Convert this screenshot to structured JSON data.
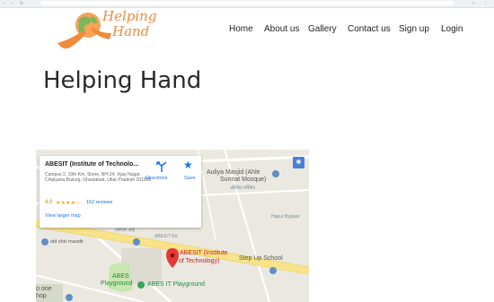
{
  "header": {
    "logo_line1": "Helping",
    "logo_line2": "Hand",
    "nav": [
      {
        "label": "Home"
      },
      {
        "label": "About us"
      },
      {
        "label": "Gallery"
      },
      {
        "label": "Contact us"
      },
      {
        "label": "Sign up"
      },
      {
        "label": "Login"
      }
    ]
  },
  "hero": {
    "title": "Helping Hand"
  },
  "map": {
    "card": {
      "name": "ABESIT (Institute of Technolo...",
      "address": "Campus 2, 19th Km, Stone, NH-24, Vijay Nagar, Chipiyana Buzurg, Ghaziabad, Uttar Pradesh 201009",
      "rating": "4.0",
      "stars": "★★★★☆",
      "reviews": "162 reviews",
      "directions": "Directions",
      "save": "Save",
      "larger_map": "View larger map"
    },
    "labels": {
      "masjid1": "Auliya Masjid (Ahle",
      "masjid2": "Sunnat Mosque)",
      "masjid_hindi": "औलिया मस्जिद",
      "old_shiv": "old shiv mandir",
      "abesit1": "ABESIT (Institute",
      "abesit2": "of Technology)",
      "stepup": "Step Up School",
      "abes_playground1": "ABES",
      "abes_playground2": "Playground",
      "abes_it_playground": "ABES IT Playground",
      "hapur_bypass": "Hapur Bypass",
      "abesit_road": "ABESIT Rd",
      "hindi_small": "एबीएस आई",
      "one1": "o one",
      "one2": "hop"
    },
    "colors": {
      "marker_red": "#e53935",
      "poi_blue": "#5f8fc4",
      "park_green": "#c8e6b0",
      "road_yellow": "#f7e38a"
    }
  }
}
